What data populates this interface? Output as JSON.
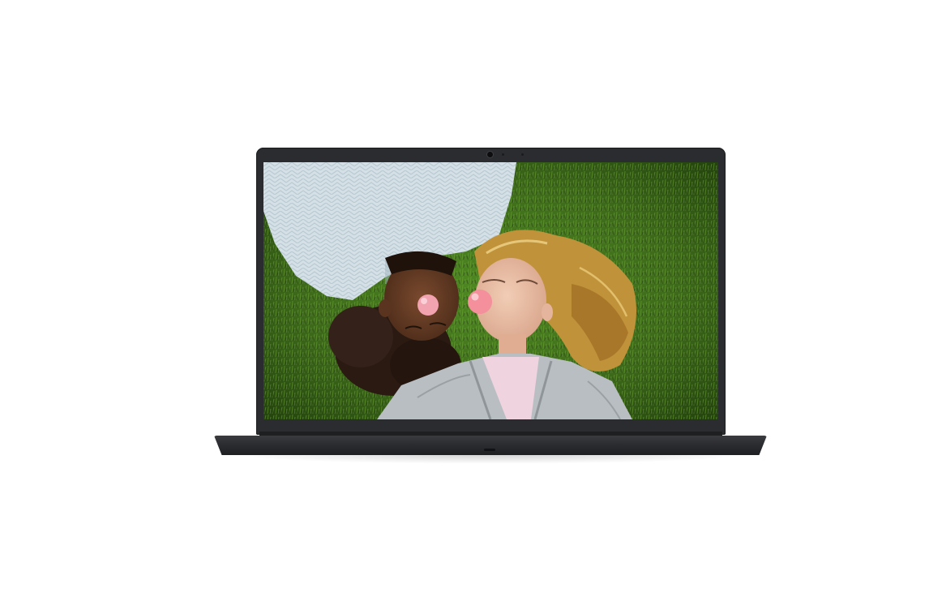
{
  "image": {
    "subject": "laptop-front-view",
    "colors": {
      "background": "#ffffff",
      "chassis": "#2b2c2f",
      "grass": "#3d6a1a",
      "sweater": "#d4e0e6",
      "jacket": "#b9bec2",
      "bubble_gum": "#f2a3b0",
      "hair_blonde": "#c0923a",
      "hair_dark": "#2a1a12"
    }
  }
}
